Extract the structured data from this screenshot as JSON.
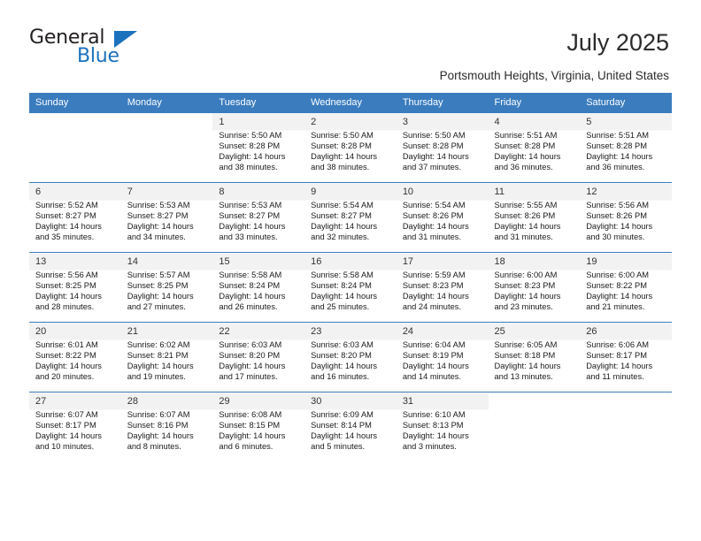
{
  "brand": {
    "name_top": "General",
    "name_bottom": "Blue",
    "triangle_icon": "brand-triangle-icon",
    "accent_color": "#1c71bd"
  },
  "header": {
    "title": "July 2025",
    "subtitle": "Portsmouth Heights, Virginia, United States"
  },
  "theme": {
    "header_row_bg": "#3a7cbe",
    "header_row_text": "#ffffff",
    "cell_number_strip": "#f2f2f2",
    "grid_line": "#3a7cbe"
  },
  "weekdays": [
    "Sunday",
    "Monday",
    "Tuesday",
    "Wednesday",
    "Thursday",
    "Friday",
    "Saturday"
  ],
  "labels": {
    "sunrise_prefix": "Sunrise:",
    "sunset_prefix": "Sunset:",
    "daylight_prefix": "Daylight:"
  },
  "weeks": [
    [
      {
        "day": "",
        "lines": []
      },
      {
        "day": "",
        "lines": []
      },
      {
        "day": "1",
        "lines": [
          "Sunrise: 5:50 AM",
          "Sunset: 8:28 PM",
          "Daylight: 14 hours",
          "and 38 minutes."
        ]
      },
      {
        "day": "2",
        "lines": [
          "Sunrise: 5:50 AM",
          "Sunset: 8:28 PM",
          "Daylight: 14 hours",
          "and 38 minutes."
        ]
      },
      {
        "day": "3",
        "lines": [
          "Sunrise: 5:50 AM",
          "Sunset: 8:28 PM",
          "Daylight: 14 hours",
          "and 37 minutes."
        ]
      },
      {
        "day": "4",
        "lines": [
          "Sunrise: 5:51 AM",
          "Sunset: 8:28 PM",
          "Daylight: 14 hours",
          "and 36 minutes."
        ]
      },
      {
        "day": "5",
        "lines": [
          "Sunrise: 5:51 AM",
          "Sunset: 8:28 PM",
          "Daylight: 14 hours",
          "and 36 minutes."
        ]
      }
    ],
    [
      {
        "day": "6",
        "lines": [
          "Sunrise: 5:52 AM",
          "Sunset: 8:27 PM",
          "Daylight: 14 hours",
          "and 35 minutes."
        ]
      },
      {
        "day": "7",
        "lines": [
          "Sunrise: 5:53 AM",
          "Sunset: 8:27 PM",
          "Daylight: 14 hours",
          "and 34 minutes."
        ]
      },
      {
        "day": "8",
        "lines": [
          "Sunrise: 5:53 AM",
          "Sunset: 8:27 PM",
          "Daylight: 14 hours",
          "and 33 minutes."
        ]
      },
      {
        "day": "9",
        "lines": [
          "Sunrise: 5:54 AM",
          "Sunset: 8:27 PM",
          "Daylight: 14 hours",
          "and 32 minutes."
        ]
      },
      {
        "day": "10",
        "lines": [
          "Sunrise: 5:54 AM",
          "Sunset: 8:26 PM",
          "Daylight: 14 hours",
          "and 31 minutes."
        ]
      },
      {
        "day": "11",
        "lines": [
          "Sunrise: 5:55 AM",
          "Sunset: 8:26 PM",
          "Daylight: 14 hours",
          "and 31 minutes."
        ]
      },
      {
        "day": "12",
        "lines": [
          "Sunrise: 5:56 AM",
          "Sunset: 8:26 PM",
          "Daylight: 14 hours",
          "and 30 minutes."
        ]
      }
    ],
    [
      {
        "day": "13",
        "lines": [
          "Sunrise: 5:56 AM",
          "Sunset: 8:25 PM",
          "Daylight: 14 hours",
          "and 28 minutes."
        ]
      },
      {
        "day": "14",
        "lines": [
          "Sunrise: 5:57 AM",
          "Sunset: 8:25 PM",
          "Daylight: 14 hours",
          "and 27 minutes."
        ]
      },
      {
        "day": "15",
        "lines": [
          "Sunrise: 5:58 AM",
          "Sunset: 8:24 PM",
          "Daylight: 14 hours",
          "and 26 minutes."
        ]
      },
      {
        "day": "16",
        "lines": [
          "Sunrise: 5:58 AM",
          "Sunset: 8:24 PM",
          "Daylight: 14 hours",
          "and 25 minutes."
        ]
      },
      {
        "day": "17",
        "lines": [
          "Sunrise: 5:59 AM",
          "Sunset: 8:23 PM",
          "Daylight: 14 hours",
          "and 24 minutes."
        ]
      },
      {
        "day": "18",
        "lines": [
          "Sunrise: 6:00 AM",
          "Sunset: 8:23 PM",
          "Daylight: 14 hours",
          "and 23 minutes."
        ]
      },
      {
        "day": "19",
        "lines": [
          "Sunrise: 6:00 AM",
          "Sunset: 8:22 PM",
          "Daylight: 14 hours",
          "and 21 minutes."
        ]
      }
    ],
    [
      {
        "day": "20",
        "lines": [
          "Sunrise: 6:01 AM",
          "Sunset: 8:22 PM",
          "Daylight: 14 hours",
          "and 20 minutes."
        ]
      },
      {
        "day": "21",
        "lines": [
          "Sunrise: 6:02 AM",
          "Sunset: 8:21 PM",
          "Daylight: 14 hours",
          "and 19 minutes."
        ]
      },
      {
        "day": "22",
        "lines": [
          "Sunrise: 6:03 AM",
          "Sunset: 8:20 PM",
          "Daylight: 14 hours",
          "and 17 minutes."
        ]
      },
      {
        "day": "23",
        "lines": [
          "Sunrise: 6:03 AM",
          "Sunset: 8:20 PM",
          "Daylight: 14 hours",
          "and 16 minutes."
        ]
      },
      {
        "day": "24",
        "lines": [
          "Sunrise: 6:04 AM",
          "Sunset: 8:19 PM",
          "Daylight: 14 hours",
          "and 14 minutes."
        ]
      },
      {
        "day": "25",
        "lines": [
          "Sunrise: 6:05 AM",
          "Sunset: 8:18 PM",
          "Daylight: 14 hours",
          "and 13 minutes."
        ]
      },
      {
        "day": "26",
        "lines": [
          "Sunrise: 6:06 AM",
          "Sunset: 8:17 PM",
          "Daylight: 14 hours",
          "and 11 minutes."
        ]
      }
    ],
    [
      {
        "day": "27",
        "lines": [
          "Sunrise: 6:07 AM",
          "Sunset: 8:17 PM",
          "Daylight: 14 hours",
          "and 10 minutes."
        ]
      },
      {
        "day": "28",
        "lines": [
          "Sunrise: 6:07 AM",
          "Sunset: 8:16 PM",
          "Daylight: 14 hours",
          "and 8 minutes."
        ]
      },
      {
        "day": "29",
        "lines": [
          "Sunrise: 6:08 AM",
          "Sunset: 8:15 PM",
          "Daylight: 14 hours",
          "and 6 minutes."
        ]
      },
      {
        "day": "30",
        "lines": [
          "Sunrise: 6:09 AM",
          "Sunset: 8:14 PM",
          "Daylight: 14 hours",
          "and 5 minutes."
        ]
      },
      {
        "day": "31",
        "lines": [
          "Sunrise: 6:10 AM",
          "Sunset: 8:13 PM",
          "Daylight: 14 hours",
          "and 3 minutes."
        ]
      },
      {
        "day": "",
        "lines": []
      },
      {
        "day": "",
        "lines": []
      }
    ]
  ]
}
